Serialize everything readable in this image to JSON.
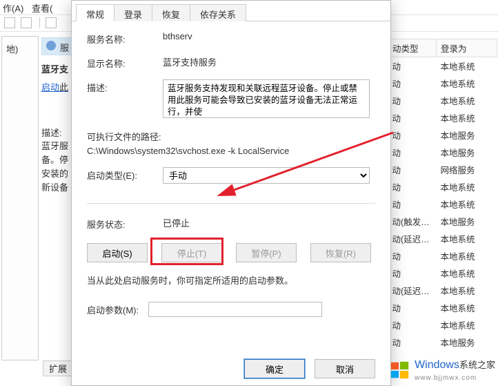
{
  "menu": {
    "action": "作(A)",
    "view": "查看("
  },
  "leftpanel": {
    "node": "地)",
    "headerIcon": "服",
    "title": "蓝牙支",
    "link": "启动",
    "linkTail": "此",
    "descHeader": "描述:",
    "descBody1": "蓝牙服",
    "descBody2": "备。停",
    "descBody3": "安装的",
    "descBody4": "新设备"
  },
  "extendBtn": "扩展",
  "bgcols": {
    "h1": "动类型",
    "h2": "登录为",
    "rows": [
      {
        "a": "动",
        "b": "本地系统"
      },
      {
        "a": "动",
        "b": "本地系统"
      },
      {
        "a": "动",
        "b": "本地系统"
      },
      {
        "a": "动",
        "b": "本地系统"
      },
      {
        "a": "动",
        "b": "本地服务"
      },
      {
        "a": "动",
        "b": "本地服务"
      },
      {
        "a": "动",
        "b": "网络服务"
      },
      {
        "a": "动",
        "b": "本地系统"
      },
      {
        "a": "动",
        "b": "本地系统"
      },
      {
        "a": "动(触发…",
        "b": "本地服务"
      },
      {
        "a": "动(延迟…",
        "b": "本地系统"
      },
      {
        "a": "动",
        "b": "本地系统"
      },
      {
        "a": "动",
        "b": "本地系统"
      },
      {
        "a": "动(延迟…",
        "b": "本地系统"
      },
      {
        "a": "动",
        "b": "本地系统"
      },
      {
        "a": "动",
        "b": "本地系统"
      },
      {
        "a": "动",
        "b": "本地服务"
      }
    ]
  },
  "dialog": {
    "tabs": {
      "general": "常规",
      "logon": "登录",
      "recovery": "恢复",
      "deps": "依存关系"
    },
    "labels": {
      "serviceName": "服务名称:",
      "displayName": "显示名称:",
      "description": "描述:",
      "exePathLabel": "可执行文件的路径:",
      "startupType": "启动类型(E):",
      "serviceStatus": "服务状态:",
      "startupParams": "启动参数(M):"
    },
    "values": {
      "serviceName": "bthserv",
      "displayName": "蓝牙支持服务",
      "description": "蓝牙服务支持发现和关联远程蓝牙设备。停止或禁用此服务可能会导致已安装的蓝牙设备无法正常运行，并使",
      "exePath": "C:\\Windows\\system32\\svchost.exe -k LocalService",
      "startupType": "手动",
      "status": "已停止",
      "note": "当从此处启动服务时，你可指定所适用的启动参数。",
      "startParam": ""
    },
    "buttons": {
      "start": "启动(S)",
      "stop": "停止(T)",
      "pause": "暂停(P)",
      "resume": "恢复(R)",
      "ok": "确定",
      "cancel": "取消"
    }
  },
  "watermark": {
    "brand": "Windows",
    "sub": "系统之家",
    "url": "www.bjjmwx.com"
  }
}
